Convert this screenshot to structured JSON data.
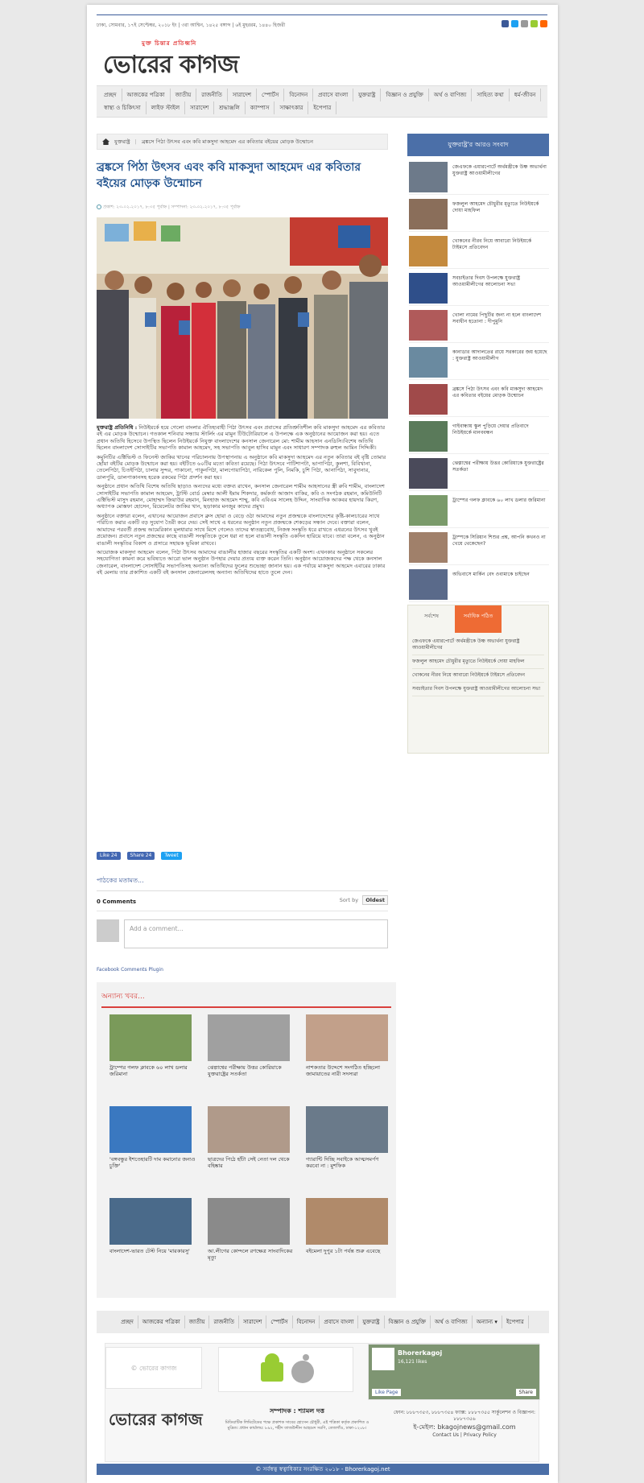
{
  "topbar": {
    "date": "ঢাকা, সোমবার, ১৭ই সেপ্টেম্বর, ২০১৮ ইং | ৩রা আশ্বিন, ১৪২৫ বঙ্গাব্দ | ৬ই মুহররম, ১৪৪০ হিজরী"
  },
  "logo": {
    "tagline": "মুক্ত চিন্তার প্রতিধ্বনি",
    "name": "ভোরের কাগজ"
  },
  "nav": [
    "প্রচ্ছদ",
    "আজকের পত্রিকা",
    "জাতীয়",
    "রাজনীতি",
    "সারাদেশ",
    "স্পোর্টস",
    "বিনোদন",
    "প্রবাসে বাংলা",
    "যুক্তরাষ্ট্র",
    "বিজ্ঞান ও প্রযুক্তি",
    "অর্থ ও বাণিজ্য",
    "সাহিত্য কথা",
    "ধর্ম-জীবন",
    "স্বাস্থ্য ও চিকিৎসা",
    "লাইফ স্টাইল",
    "সারাদেশ",
    "শ্রদ্ধাঞ্জলি",
    "ক্যাম্পাস",
    "সাক্ষাৎকার",
    "ইপেপার"
  ],
  "breadcrumb": {
    "section": "যুক্তরাষ্ট্র",
    "current": "ব্রঙ্কসে পিঠা উৎসব এবং কবি মাকসুদা আহমেদ এর কবিতার বইয়ের মোড়ক উন্মোচন"
  },
  "article": {
    "title": "ব্রঙ্কসে পিঠা উৎসব এবং কবি মাকসুদা আহমেদ এর কবিতার বইয়ের মোড়ক উন্মোচন",
    "meta": "প্রকাশ: ২৩-০২-২০১৭, ৮:৩৫ পূর্বাহ্ন | সম্পাদনা: ২৩-০২-২০১৭, ৮:৩৫ পূর্বাহ্ন",
    "byline": "যুক্তরাষ্ট্র প্রতিনিধি :",
    "paragraphs": [
      "নিউইয়র্কে হয়ে গেলো বাংলার ঐতিহ্যবাহী পিঠা উৎসব এবং প্রবাসের প্রতিশ্রুতিশীল কবি মাকসুদা আহমেদ এর কবিতার বই এর মোড়ক উন্মোচন। গতকাল শনিবার সন্ধ্যায় স্টার্লিং এর মামুন টিউটোরিয়ালে এ উপলক্ষে এক অনুষ্ঠানের আয়োজন করা হয়। এতে প্রধান অতিথি হিসেবে উপস্থিত ছিলেন নিউইয়র্কে নিযুক্ত বাংলাদেশের কনসাল জেনারেল মো: শামীম আহসান এনডিসি।বিশেষ অতিথি ছিলেন বাংলাদেশ সোসাইটির সভাপতি কামাল আহমেদ, সহ সভাপতি আবুল হাসিব মামুন এবং সাধারণ সম্পাদক রুহুল আমিন সিদ্দিকী।",
      "কমুনিটির এক্টিভিস্ট ও ফিনেস্ট জাকির খানের পরিচালনায় উপস্থাপনায় এ অনুষ্ঠানে কবি মাকসুদা আহমেদ এর নতুন কবিতার বই বৃষ্টি তোমার ছোঁয়া বইটির মোড়ক উন্মোচন করা হয়। বইটিতে ৬০টির মতো কবিতা রয়েছে। পিঠা উৎসবে পাটিশাপটা, ভাপাপিঠা, কুলশা, বিবিখানা, তেলেপিঠা, চিতইপিঠা, চালার সুন্দর, পাকানো, পাকুনপিঠা, মালপোয়াপিঠা, নারিকেল পুলি, নিমকি, চুশি পিঠা, আনাপিঠা, সাবুদানার, ডালপুরি, ডালপাকানসহ হরেক রকমের পিঠা প্রদর্শন করা হয়।",
      "অনুষ্ঠানে প্রধান অতিথি বিশেষ অতিথি ছাড়াও অন্যদের মধ্যে বক্তব্য রাখেন, কনসাল জেনারেল শামীম আহসানের স্ত্রী রুবি শামীম, বাংলাদেশ সোসাইটির সভাপতি কামাল আহমেদ, ট্রাস্টি বোর্ড মেম্বার আলী ইমাম শিকদার, কর্মকর্তা আজাদ বাকির, কবি ও সংগঠক রহমান, কমিউনিটি এক্টিভিস্ট মাসুদ রহমান, মোহাম্মদ জিয়াউর রহমান, মিনহাজ আহমেদ শাম্মু, কবি এবিএম সালেহ উদ্দিন, সাংবাদিক আকবর হায়দার কিরণ, অধ্যাপক মোস্তফা হোসেন, রিয়েলেটর জাকির খান, ছড়াকার মনজুর কাদের প্রমুখ।",
      "অনুষ্ঠানে বক্তারা বলেন, এখানের আয়োজন প্রবাসে ব্রুস হোয়া ও বেড়ে ওঠা আমাদের নতুন প্রজন্মকে বাংলাদেশের কৃষ্টি-কালচারের সাথে পরিচিত করার একটি বড় সুযোগ তৈরী করে দেয়। সেই সাথে এ ধরনের অনুষ্ঠান নতুন প্রজন্মকে শেকড়ের সন্ধান দেবে। বক্তারা বলেন, আমাদের পরবর্তী প্রজন্ম আমেরিকান মূলধারার সাথে মিশে গেলেও তাদের স্বাতন্ত্র্যবোধ, নিজস্ব সংস্কৃতি ধরে রাখতে এধরনের উৎসব খুবই প্রয়োজন। প্রবাসে নতুন প্রজন্মের কাছে বাঙালী সংস্কৃতিকে তুলে ধরা না হলে বাঙালী সংস্কৃতি একদিন হারিয়ে যাবে। তারা বলেন, এ অনুষ্ঠান বাঙালী সংস্কৃতির বিকাশ ও প্রসারে সহায়ক ভূমিকা রাখবে।",
      "আয়োজক মাকসুদা আহমেদ বলেন, পিঠা উৎসব আমাদের বাঙালীর হাজার বছরের সংস্কৃতির একটি অংশ। এখনকার অনুষ্ঠানে সকলের সহযোগিতা কামনা করে ভবিষ্যতে আরো ভাল অনুষ্ঠান উপহার দেয়ার প্রত্যয় ব্যক্ত করেন তিনি। অনুষ্ঠান আয়োজকদের পক্ষ থেকে কনসাল জেনারেল, বাংলাদেশ সোসাইটির সভাপতিসহ অন্যান্য অতিথিদের ফুলের শুভেচ্ছা জানান হয়। এক পর্যায়ে মাকসুদা আহমেদ এবারের ঢাকার বই মেলায় তার প্রকাশিত একটি বই কনসাল জেনারেলসহ অন্যান্য অতিথিদের হাতে তুলে দেন।"
    ]
  },
  "share": {
    "like": "Like 24",
    "share": "Share 24",
    "tweet": "Tweet"
  },
  "comments": {
    "readers": "পাঠকের মতামত...",
    "count": "0 Comments",
    "sort_label": "Sort by",
    "sort_value": "Oldest",
    "placeholder": "Add a comment...",
    "plugin": "Facebook Comments Plugin"
  },
  "other_news": {
    "title": "অন্যান্য খবর...",
    "items": [
      "ট্রাম্পের গলফ ক্লাবকে ৬০ লাখ ডলার জরিমানা",
      "ঝেল্পাশ্বের পরীক্ষায় উত্তর কোরিয়াকে যুক্তরাষ্ট্রের সতর্কতা",
      "নাশকতার উদ্দেশে সংগঠিত হচ্ছিলো জামায়াতের নারী সদস্যরা",
      "'বঙ্গবন্ধুর ইশতেহারটি দাম কমানোর জন্যও চুক্তি'",
      "ছাত্রদের পিঠে হাঁটা সেই নেতা দল থেকে বহিষ্কার",
      "গ্যারান্টি দিচ্ছি সবাইকে আত্মসমর্পণ করবো না : মুশফিক",
      "বাংলাদেশ-ভারত টেস্ট নিয়ে 'মারকারসু'",
      "আ.লীগের কোন্দলে রণক্ষেত্র সাংবাদিকের মৃত্যু",
      "বইমেলা দুপুর ১টা পর্যন্ত শুরু এবেছে"
    ]
  },
  "sidebar": {
    "title": "যুক্তরাষ্ট্র'র আরও সংবাদ",
    "items": [
      "জেএফকে এয়ারপোর্টে অর্থমন্ত্রীকে উষ্ণ অভ্যর্থনা যুক্তরাষ্ট্র আওয়ামীলীগের",
      "ফজলুল আহমেদ চৌধুরীর মৃত্যুতে নিউইয়র্কে দোয়া মাহফিল",
      "খোকনের নীরব নিয়ে আবারো নিউইয়র্কে টাইমসে প্রতিবেদন",
      "সবচাইতার দিবস উপলক্ষে যুক্তরাষ্ট্র আওয়ামীলীগের আলোচনা সভা",
      "খোলা নামের পিছুটির জন্য না হলে বাংলাদেশ সবাধীন হতোনা : দীপুমুনি",
      "কানাডার আদালতের রায়ে সরকারের জয় হয়েছে : যুক্তরাষ্ট্র আওয়ামীলীগ",
      "ব্রঙ্কসে পিঠা উৎসব এবং কবি মাকসুদা আহমেদ এর কবিতার বইয়ের মোড়ক উন্মোচন",
      "গাইবান্ধায় স্কুল পুড়িয়ে দেয়ার প্রতিবাদে নিউইয়র্কে মানববন্ধন",
      "ঝেল্পাশ্বের পরীক্ষায় উত্তর কোরিয়াকে যুক্তরাষ্ট্রের সতর্কতা",
      "ট্রাম্পের গলফ ক্লাবকে ৬০ লাখ ডলার জরিমানা",
      "ট্রাম্পকে সিরিয়ান শিশুর প্রশ্ন, আপনি কখনও না খেয়ে থেকেছেন?",
      "অভিবাসে মার্কিন বেদ ওবামাকে চাইছেন"
    ],
    "tabs": [
      "সর্বশেষ",
      "সর্বাধিক পঠিত"
    ],
    "tab_items": [
      "জেএফকে এয়ারপোর্টে অর্থমন্ত্রীকে উষ্ণ অভ্যর্থনা যুক্তরাষ্ট্র আওয়ামীলীগের",
      "ফজলুল আহমেদ চৌধুরীর মৃত্যুতে নিউইয়র্কে দোয়া মাহফিল",
      "খোকনের নীরব নিয়ে আবারো নিউইয়র্কে টাইমসে প্রতিবেদন",
      "সবচাইতার দিবস উপলক্ষে যুক্তরাষ্ট্র আওয়ামীলীগের আলোচনা সভা"
    ]
  },
  "footer": {
    "nav": [
      "প্রচ্ছদ",
      "আজকের পত্রিকা",
      "জাতীয়",
      "রাজনীতি",
      "সারাদেশ",
      "স্পোর্টস",
      "বিনোদন",
      "প্রবাসে বাংলা",
      "যুক্তরাষ্ট্র",
      "বিজ্ঞান ও প্রযুক্তি",
      "অর্থ ও বাণিজ্য",
      "অন্যান্য ▾",
      "ইপেপার"
    ],
    "brand_small": "© ভোরের কাগজ",
    "fb_name": "Bhorerkagoj",
    "fb_likes": "16,121 likes",
    "fb_like_btn": "Like Page",
    "fb_share_btn": "Share",
    "logo": "ভোরের কাগজ",
    "editor": "সম্পাদক : শ্যামল দত্ত",
    "address": "মিডিয়াটিক লিমিটেডের পক্ষে প্রকাশক সাবের হোসেন চৌধুরী, এই পত্রিকা কর্তৃক প্রকাশিত ও মুদ্রিত। প্রধান কার্যালয়: ৮৯২, শহীদ তাজউদ্দীন আহমেদ সরণি, তেজগাঁও, ঢাকা-১২০৮।",
    "phones": "ফোন: ৮৮৮৭৩৫৩, ৮৮৮৭৩৫৪ ফ্যাক্স: ৮৮৮৭৩৫৫ সার্কুলেশন ও বিজ্ঞাপন: ৮৮৮৭৩৫৬",
    "email": "bkagojnews@gmail.com",
    "email_label": "ই-মেইল:",
    "contact": "Contact Us",
    "privacy": "Privacy Policy",
    "copyright": "© সর্বস্বত্ব স্বত্বাধিকার সংরক্ষিত ২০১৮ - Bhorerkagoj.net"
  },
  "colors": {
    "brand_blue": "#4b6fa8",
    "accent_red": "#d9403c",
    "tab_orange": "#ee6b34"
  }
}
